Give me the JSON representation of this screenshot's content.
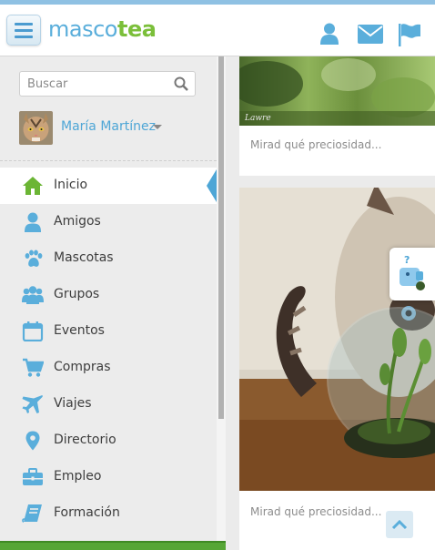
{
  "header": {
    "logo_part1": "masco",
    "logo_part2": "tea",
    "icons": [
      "menu-icon",
      "user-icon",
      "envelope-icon",
      "flag-icon"
    ],
    "accent_color": "#5aaedb",
    "brand_green": "#7bbf3a"
  },
  "sidebar": {
    "search_placeholder": "Buscar",
    "user_name": "María Martínez",
    "items": [
      {
        "label": "Inicio",
        "icon": "home-icon",
        "active": true
      },
      {
        "label": "Amigos",
        "icon": "user-icon"
      },
      {
        "label": "Mascotas",
        "icon": "paw-icon"
      },
      {
        "label": "Grupos",
        "icon": "group-icon"
      },
      {
        "label": "Eventos",
        "icon": "calendar-icon"
      },
      {
        "label": "Compras",
        "icon": "cart-icon"
      },
      {
        "label": "Viajes",
        "icon": "plane-icon"
      },
      {
        "label": "Directorio",
        "icon": "map-marker-icon"
      },
      {
        "label": "Empleo",
        "icon": "briefcase-icon"
      },
      {
        "label": "Formación",
        "icon": "book-icon"
      }
    ]
  },
  "feed": {
    "posts": [
      {
        "caption": "Mirad qué preciosidad..."
      },
      {
        "caption": "Mirad qué preciosidad..."
      }
    ]
  }
}
